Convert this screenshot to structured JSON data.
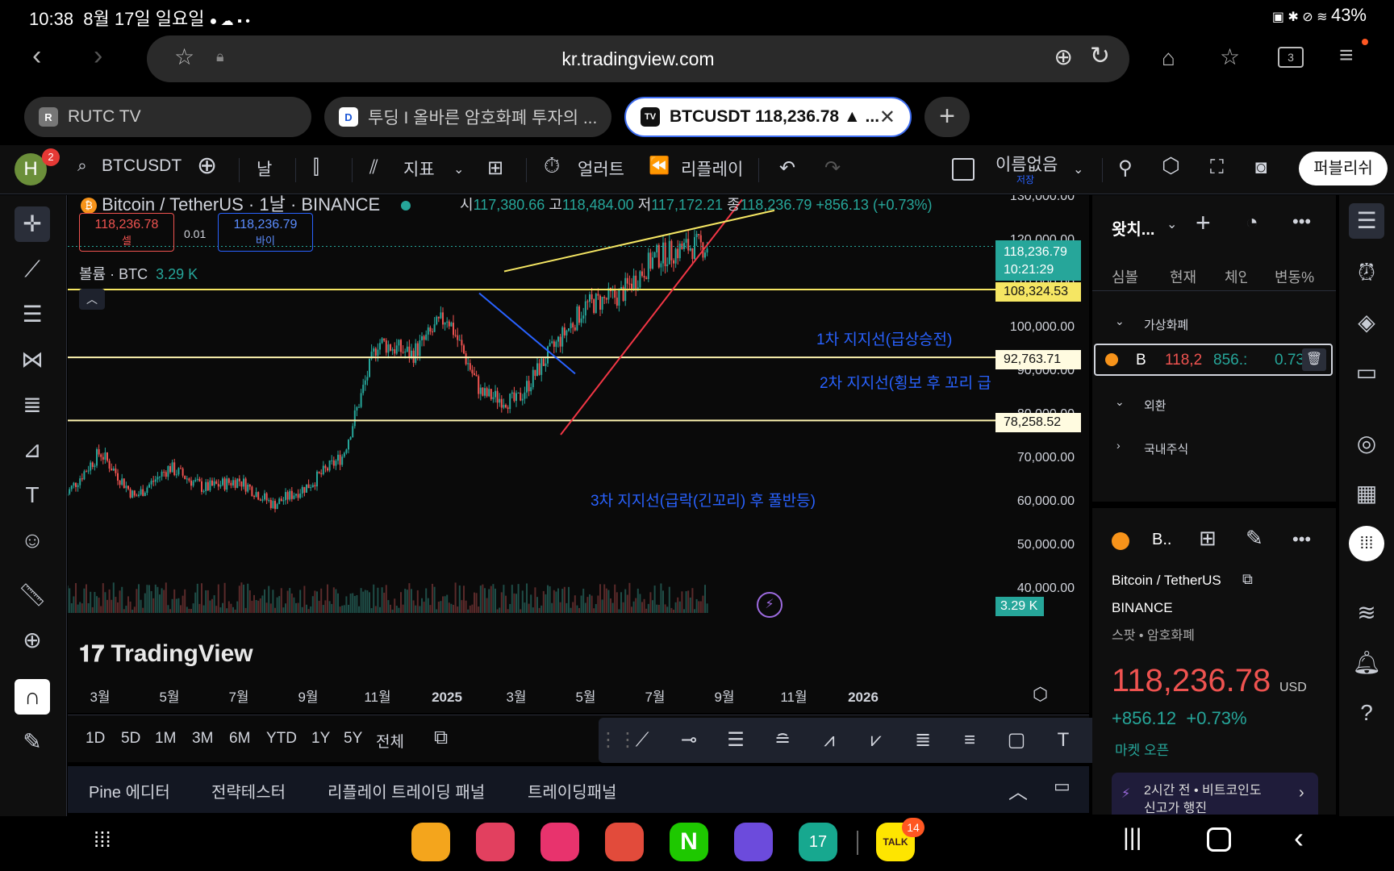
{
  "status_bar": {
    "time": "10:38",
    "date": "8월 17일 일요일",
    "battery": "43%"
  },
  "browser": {
    "url": "kr.tradingview.com",
    "tab_count": "3",
    "tabs": [
      {
        "favicon": "R",
        "label": "RUTC TV"
      },
      {
        "favicon": "D",
        "label": "투딩 I 올바른 암호화폐 투자의 ..."
      },
      {
        "favicon": "TV",
        "label": "BTCUSDT 118,236.78 ▲ ..."
      }
    ]
  },
  "toolbar": {
    "avatar": "H",
    "avatar_badge": "2",
    "symbol": "BTCUSDT",
    "interval": "날",
    "indicators": "지표",
    "alert": "얼러트",
    "replay": "리플레이",
    "layout_name": "이름없음",
    "layout_sub": "저장",
    "publish": "퍼블리쉬"
  },
  "legend": {
    "title": "Bitcoin / TetherUS · 1날 · BINANCE",
    "o_label": "시",
    "o": "117,380.66",
    "h_label": "고",
    "h": "118,484.00",
    "l_label": "저",
    "l": "117,172.21",
    "c_label": "종",
    "c": "118,236.79",
    "change": "+856.13 (+0.73%)",
    "sell_price": "118,236.78",
    "sell_label": "셀",
    "spread": "0.01",
    "buy_price": "118,236.79",
    "buy_label": "바이",
    "volume_label": "볼륨 · BTC",
    "volume_value": "3.29 K"
  },
  "price_axis": {
    "ticks": [
      "130,000.00",
      "120,000.00",
      "110,000.00",
      "100,000.00",
      "90,000.00",
      "80,000.00",
      "70,000.00",
      "60,000.00",
      "50,000.00",
      "40,000.00"
    ],
    "current_price": "118,236.79",
    "countdown": "10:21:29",
    "level_labels": [
      "108,324.53",
      "92,763.71",
      "78,258.52"
    ],
    "volume_tag": "3.29 K"
  },
  "time_axis": [
    "3월",
    "5월",
    "7월",
    "9월",
    "11월",
    "2025",
    "3월",
    "5월",
    "7월",
    "9월",
    "11월",
    "2026"
  ],
  "annotations": [
    {
      "text": "1차 지지선(급상승전)"
    },
    {
      "text": "2차 지지선(횡보 후 꼬리 급"
    },
    {
      "text": "3차 지지선(급락(긴꼬리) 후 풀반등)"
    }
  ],
  "watermark": "TradingView",
  "ranges": [
    "1D",
    "5D",
    "1M",
    "3M",
    "6M",
    "YTD",
    "1Y",
    "5Y",
    "전체"
  ],
  "panels": [
    "Pine 에디터",
    "전략테스터",
    "리플레이 트레이딩 패널",
    "트레이딩패널"
  ],
  "watchlist": {
    "title": "왓치...",
    "columns": [
      "심볼",
      "현재",
      "체인",
      "변동%"
    ],
    "groups": [
      "가상화폐",
      "외환",
      "국내주식"
    ],
    "row": {
      "symbol": "B",
      "price": "118,2",
      "change": "856.:",
      "pct": "0.73"
    }
  },
  "detail": {
    "symbol_short": "B..",
    "name": "Bitcoin / TetherUS",
    "exchange": "BINANCE",
    "type": "스팟 • 암호화폐",
    "price": "118,236.78",
    "currency": "USD",
    "change": "+856.12",
    "change_pct": "+0.73%",
    "market": "마켓 오픈",
    "news_time": "2시간 전",
    "news_src": "비트코인도",
    "news_line2": "신고가 행진"
  },
  "dock_badge": "14",
  "dock_talk": "TALK",
  "dock_calendar": "17",
  "colors": {
    "up": "#26a69a",
    "down": "#ef5350",
    "level": "#f5e663",
    "accent": "#2962ff"
  },
  "chart_data": {
    "type": "candlestick",
    "ylim": [
      35000,
      132000
    ],
    "levels": [
      108324.53,
      92763.71,
      78258.52
    ],
    "monthly_close": [
      {
        "x": "2024-02",
        "y": 61000
      },
      {
        "x": "2024-03",
        "y": 71000
      },
      {
        "x": "2024-04",
        "y": 60600
      },
      {
        "x": "2024-05",
        "y": 67500
      },
      {
        "x": "2024-06",
        "y": 62700
      },
      {
        "x": "2024-07",
        "y": 64600
      },
      {
        "x": "2024-08",
        "y": 58900
      },
      {
        "x": "2024-09",
        "y": 63300
      },
      {
        "x": "2024-10",
        "y": 70200
      },
      {
        "x": "2024-11",
        "y": 96400
      },
      {
        "x": "2024-12",
        "y": 93400
      },
      {
        "x": "2025-01",
        "y": 102400
      },
      {
        "x": "2025-02",
        "y": 84300
      },
      {
        "x": "2025-03",
        "y": 82500
      },
      {
        "x": "2025-04",
        "y": 94200
      },
      {
        "x": "2025-05",
        "y": 104600
      },
      {
        "x": "2025-06",
        "y": 107100
      },
      {
        "x": "2025-07",
        "y": 115700
      },
      {
        "x": "2025-08",
        "y": 118236
      }
    ]
  }
}
